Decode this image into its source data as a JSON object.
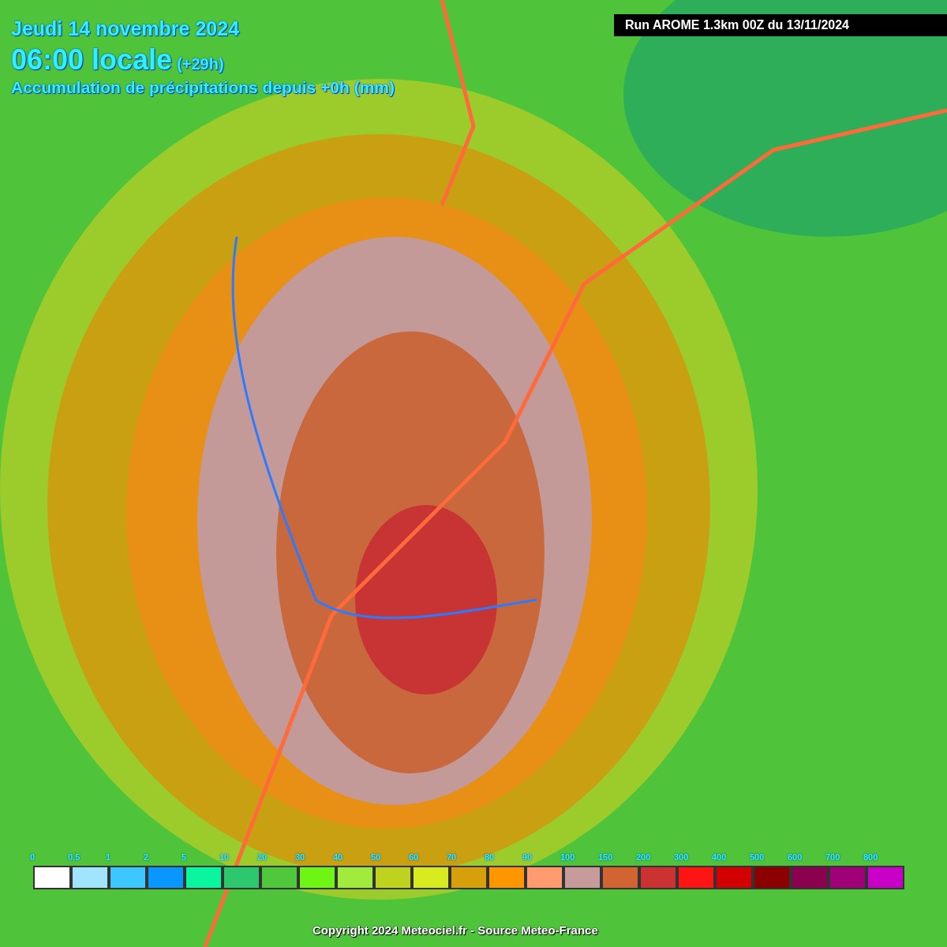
{
  "header": {
    "date": "Jeudi 14 novembre 2024",
    "time": "06:00 locale",
    "offset": "(+29h)",
    "subtitle": "Accumulation de précipitations depuis +0h (mm)"
  },
  "run_label": "Run AROME 1.3km 00Z du 13/11/2024",
  "legend": [
    {
      "label": "0",
      "color": "#ffffff"
    },
    {
      "label": "0.5",
      "color": "#a0e4ff"
    },
    {
      "label": "1",
      "color": "#3cc8ff"
    },
    {
      "label": "2",
      "color": "#0a96ff"
    },
    {
      "label": "5",
      "color": "#0af5a0"
    },
    {
      "label": "10",
      "color": "#2dc86e"
    },
    {
      "label": "20",
      "color": "#50c83c"
    },
    {
      "label": "30",
      "color": "#6ef514"
    },
    {
      "label": "40",
      "color": "#a0eb3c"
    },
    {
      "label": "50",
      "color": "#bed21e"
    },
    {
      "label": "60",
      "color": "#d7eb1e"
    },
    {
      "label": "70",
      "color": "#d7a00a"
    },
    {
      "label": "80",
      "color": "#ff9600"
    },
    {
      "label": "90",
      "color": "#ff9b6e"
    },
    {
      "label": "100",
      "color": "#c89b9b"
    },
    {
      "label": "150",
      "color": "#d26432"
    },
    {
      "label": "200",
      "color": "#cd3232"
    },
    {
      "label": "300",
      "color": "#ff1414"
    },
    {
      "label": "400",
      "color": "#d20000"
    },
    {
      "label": "500",
      "color": "#8c0000"
    },
    {
      "label": "600",
      "color": "#8c0050"
    },
    {
      "label": "700",
      "color": "#a00078"
    },
    {
      "label": "800",
      "color": "#c800c8"
    }
  ],
  "copyright": "Copyright 2024 Meteociel.fr - Source Meteo-France"
}
